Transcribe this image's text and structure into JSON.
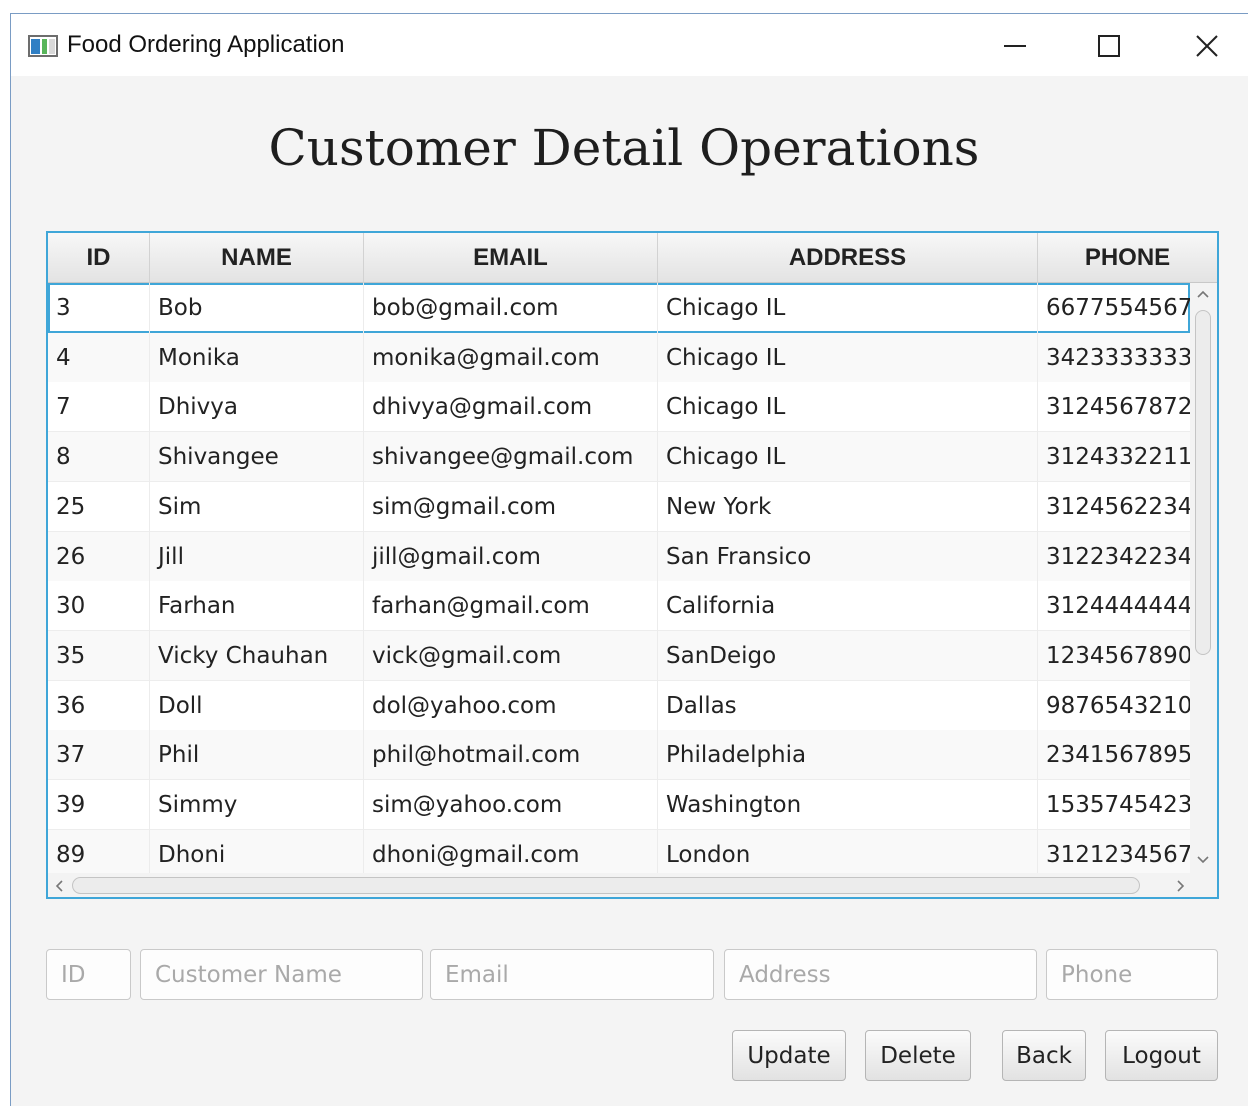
{
  "window": {
    "title": "Food Ordering Application",
    "controls": {
      "minimize": "minimize-icon",
      "maximize": "maximize-icon",
      "close": "close-icon"
    }
  },
  "page": {
    "title": "Customer Detail Operations"
  },
  "table": {
    "columns": [
      "ID",
      "NAME",
      "EMAIL",
      "ADDRESS",
      "PHONE"
    ],
    "selected_row": 0,
    "rows": [
      [
        "3",
        "Bob",
        "bob@gmail.com",
        "Chicago IL",
        "6677554567"
      ],
      [
        "4",
        "Monika",
        "monika@gmail.com",
        "Chicago IL",
        "3423333333"
      ],
      [
        "7",
        "Dhivya",
        "dhivya@gmail.com",
        "Chicago IL",
        "3124567872"
      ],
      [
        "8",
        "Shivangee",
        "shivangee@gmail.com",
        "Chicago IL",
        "3124332211"
      ],
      [
        "25",
        "Sim",
        "sim@gmail.com",
        "New York",
        "3124562234"
      ],
      [
        "26",
        "Jill",
        "jill@gmail.com",
        "San Fransico",
        "3122342234"
      ],
      [
        "30",
        "Farhan",
        "farhan@gmail.com",
        "California",
        "3124444444"
      ],
      [
        "35",
        "Vicky Chauhan",
        "vick@gmail.com",
        "SanDeigo",
        "1234567890"
      ],
      [
        "36",
        "Doll",
        "dol@yahoo.com",
        "Dallas",
        "9876543210"
      ],
      [
        "37",
        "Phil",
        "phil@hotmail.com",
        "Philadelphia",
        "2341567895"
      ],
      [
        "39",
        "Simmy",
        "sim@yahoo.com",
        "Washington",
        "1535745423"
      ],
      [
        "89",
        "Dhoni",
        "dhoni@gmail.com",
        "London",
        "3121234567"
      ]
    ]
  },
  "form": {
    "id_placeholder": "ID",
    "name_placeholder": "Customer Name",
    "email_placeholder": "Email",
    "address_placeholder": "Address",
    "phone_placeholder": "Phone"
  },
  "actions": {
    "update_label": "Update",
    "delete_label": "Delete",
    "back_label": "Back",
    "logout_label": "Logout"
  },
  "colors": {
    "accent": "#3fa6d8",
    "background": "#f4f4f4"
  }
}
